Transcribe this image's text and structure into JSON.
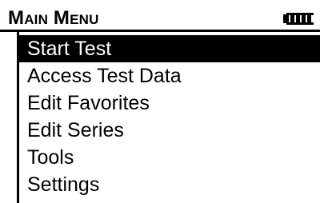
{
  "header": {
    "title": "Main Menu",
    "battery_icon": "battery-icon",
    "battery_level": 1.0
  },
  "menu": {
    "selected_index": 0,
    "items": [
      {
        "label": "Start Test"
      },
      {
        "label": "Access Test Data"
      },
      {
        "label": "Edit Favorites"
      },
      {
        "label": "Edit Series"
      },
      {
        "label": "Tools"
      },
      {
        "label": "Settings"
      }
    ]
  },
  "colors": {
    "foreground": "#000000",
    "background": "#ffffff",
    "selection_background": "#000000",
    "selection_text": "#ffffff"
  }
}
